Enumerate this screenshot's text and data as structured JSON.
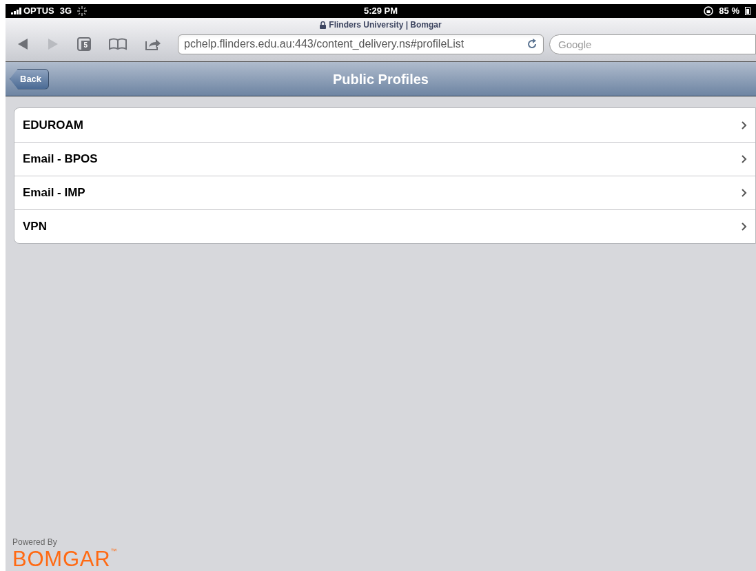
{
  "status_bar": {
    "carrier": "OPTUS",
    "network": "3G",
    "time": "5:29 PM",
    "battery": "85 %"
  },
  "browser": {
    "page_title": "Flinders University | Bomgar",
    "tab_count": "5",
    "url": "pchelp.flinders.edu.au:443/content_delivery.ns#profileList",
    "search": {
      "placeholder": "Google"
    }
  },
  "nav_bar": {
    "back": "Back",
    "title": "Public Profiles"
  },
  "profiles": [
    {
      "label": "EDUROAM"
    },
    {
      "label": "Email - BPOS"
    },
    {
      "label": "Email - IMP"
    },
    {
      "label": "VPN"
    }
  ],
  "footer": {
    "powered_by": "Powered By",
    "brand": "BOMGAR",
    "trademark": "™"
  }
}
